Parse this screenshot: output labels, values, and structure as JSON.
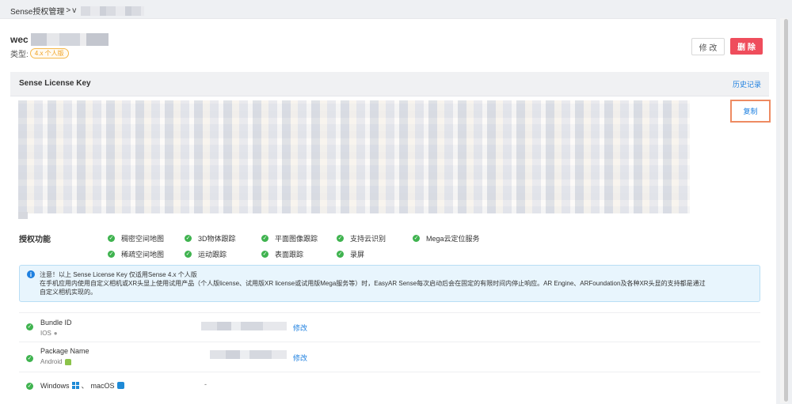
{
  "breadcrumb": {
    "root": "Sense授权管理",
    "separator": ">",
    "current_prefix": "v"
  },
  "app": {
    "name_prefix": "wec",
    "type_label": "类型:",
    "type_badge": "4.x 个人版"
  },
  "actions": {
    "edit_label": "修 改",
    "delete_label": "删 除"
  },
  "key_section": {
    "title": "Sense License Key",
    "history_label": "历史记录",
    "copy_label": "复制"
  },
  "features": {
    "label": "授权功能",
    "items": [
      "稠密空间地图",
      "3D物体跟踪",
      "平面图像跟踪",
      "支持云识别",
      "Mega云定位服务",
      "稀疏空间地图",
      "运动跟踪",
      "表面跟踪",
      "录屏"
    ]
  },
  "notice": {
    "line1": "注意！以上 Sense License Key 仅适用Sense 4.x 个人版",
    "line2": "在手机应用内使用自定义相机或XR头显上使用试用产品（个人版license、试用版XR license或试用版Mega服务等）时，EasyAR Sense每次启动后会在固定的有限时间内停止响应。AR Engine、ARFoundation及各种XR头显的支持都是通过",
    "line3": "自定义相机实现的。"
  },
  "bundles": [
    {
      "title": "Bundle ID",
      "platform": "IOS",
      "edit_label": "修改"
    },
    {
      "title": "Package Name",
      "platform": "Android",
      "edit_label": "修改"
    }
  ],
  "desktop": {
    "windows": "Windows",
    "separator": "、",
    "mac": "macOS",
    "value": "-"
  },
  "colors": {
    "accent": "#1e80e0",
    "danger": "#ef4d5c",
    "success": "#3fb34f",
    "badge": "#f0a020"
  }
}
